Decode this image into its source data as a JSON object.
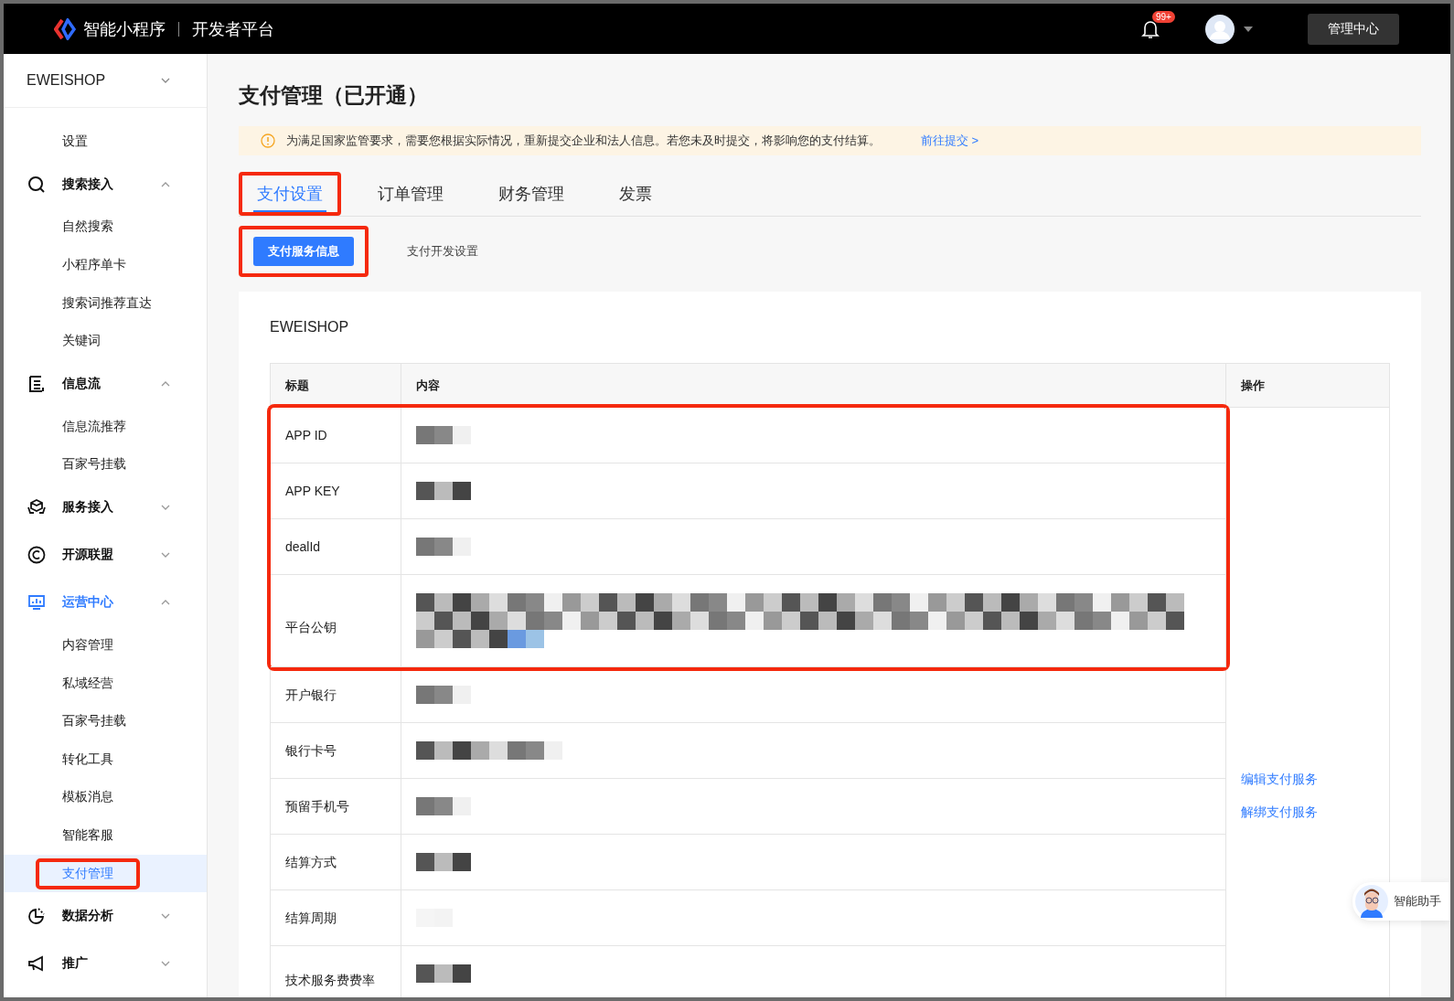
{
  "topbar": {
    "brand": "智能小程序",
    "platform": "开发者平台",
    "notification_badge": "99+",
    "admin_button": "管理中心"
  },
  "sidebar": {
    "account": "EWEISHOP",
    "items": [
      {
        "kind": "link",
        "label": "设置",
        "selected": false,
        "highlighted": false
      },
      {
        "kind": "group",
        "label": "搜索接入",
        "expanded": true,
        "active": false,
        "children": [
          {
            "label": "自然搜索",
            "selected": false,
            "highlighted": false
          },
          {
            "label": "小程序单卡",
            "selected": false,
            "highlighted": false
          },
          {
            "label": "搜索词推荐直达",
            "selected": false,
            "highlighted": false
          },
          {
            "label": "关键词",
            "selected": false,
            "highlighted": false
          }
        ]
      },
      {
        "kind": "group",
        "label": "信息流",
        "expanded": true,
        "active": false,
        "children": [
          {
            "label": "信息流推荐",
            "selected": false,
            "highlighted": false
          },
          {
            "label": "百家号挂载",
            "selected": false,
            "highlighted": false
          }
        ]
      },
      {
        "kind": "group",
        "label": "服务接入",
        "expanded": false,
        "active": false
      },
      {
        "kind": "group",
        "label": "开源联盟",
        "expanded": false,
        "active": false
      },
      {
        "kind": "group",
        "label": "运营中心",
        "expanded": true,
        "active": true,
        "children": [
          {
            "label": "内容管理",
            "selected": false,
            "highlighted": false
          },
          {
            "label": "私域经营",
            "selected": false,
            "highlighted": false
          },
          {
            "label": "百家号挂载",
            "selected": false,
            "highlighted": false
          },
          {
            "label": "转化工具",
            "selected": false,
            "highlighted": false
          },
          {
            "label": "模板消息",
            "selected": false,
            "highlighted": false
          },
          {
            "label": "智能客服",
            "selected": false,
            "highlighted": false
          },
          {
            "label": "支付管理",
            "selected": true,
            "highlighted": true
          }
        ]
      },
      {
        "kind": "group",
        "label": "数据分析",
        "expanded": false,
        "active": false
      },
      {
        "kind": "group",
        "label": "推广",
        "expanded": false,
        "active": false
      }
    ]
  },
  "page": {
    "title": "支付管理（已开通）",
    "alert": {
      "text": "为满足国家监管要求，需要您根据实际情况，重新提交企业和法人信息。若您未及时提交，将影响您的支付结算。",
      "link": "前往提交 >"
    },
    "tabs": [
      {
        "label": "支付设置",
        "selected": true,
        "highlighted": true
      },
      {
        "label": "订单管理",
        "selected": false,
        "highlighted": false
      },
      {
        "label": "财务管理",
        "selected": false,
        "highlighted": false
      },
      {
        "label": "发票",
        "selected": false,
        "highlighted": false
      }
    ],
    "subtabs": [
      {
        "label": "支付服务信息",
        "selected": true,
        "highlighted": true
      },
      {
        "label": "支付开发设置",
        "selected": false,
        "highlighted": false
      }
    ],
    "card": {
      "heading": "EWEISHOP",
      "table": {
        "columns": [
          "标题",
          "内容",
          "操作"
        ],
        "rows": [
          {
            "title": "APP ID",
            "kind": "short",
            "highlighted": true
          },
          {
            "title": "APP KEY",
            "kind": "short",
            "highlighted": true
          },
          {
            "title": "dealId",
            "kind": "short",
            "highlighted": true
          },
          {
            "title": "平台公钥",
            "kind": "long",
            "highlighted": true
          },
          {
            "title": "开户银行",
            "kind": "short",
            "highlighted": false
          },
          {
            "title": "银行卡号",
            "kind": "medium",
            "highlighted": false
          },
          {
            "title": "预留手机号",
            "kind": "short",
            "highlighted": false
          },
          {
            "title": "结算方式",
            "kind": "short",
            "highlighted": false
          },
          {
            "title": "结算周期",
            "kind": "faint",
            "highlighted": false
          },
          {
            "title": "技术服务费费率",
            "kind": "short",
            "highlighted": false
          }
        ],
        "actions": [
          "编辑支付服务",
          "解绑支付服务"
        ]
      }
    }
  },
  "assistant": {
    "label": "智能助手"
  }
}
